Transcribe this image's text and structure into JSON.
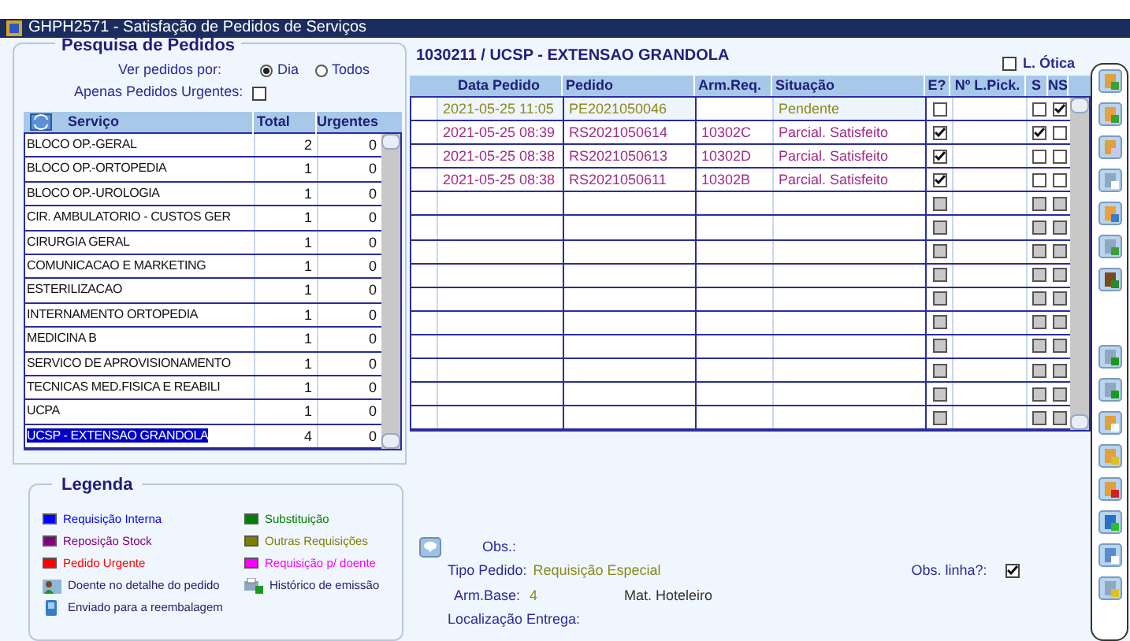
{
  "window": {
    "title": "GHPH2571 - Satisfação de Pedidos de Serviços"
  },
  "search": {
    "title": "Pesquisa de Pedidos",
    "view_label": "Ver pedidos por:",
    "view_options": [
      {
        "label": "Dia",
        "selected": true
      },
      {
        "label": "Todos",
        "selected": false
      }
    ],
    "urgent_label": "Apenas Pedidos Urgentes:",
    "urgent_checked": false
  },
  "services": {
    "columns": [
      "Serviço",
      "Total",
      "Urgentes"
    ],
    "rows": [
      {
        "name": "BLOCO OP.-GERAL",
        "total": "2",
        "urgent": "0",
        "selected": false
      },
      {
        "name": "BLOCO OP.-ORTOPEDIA",
        "total": "1",
        "urgent": "0",
        "selected": false
      },
      {
        "name": "BLOCO OP.-UROLOGIA",
        "total": "1",
        "urgent": "0",
        "selected": false
      },
      {
        "name": "CIR. AMBULATORIO - CUSTOS GER",
        "total": "1",
        "urgent": "0",
        "selected": false
      },
      {
        "name": "CIRURGIA GERAL",
        "total": "1",
        "urgent": "0",
        "selected": false
      },
      {
        "name": "COMUNICACAO E MARKETING",
        "total": "1",
        "urgent": "0",
        "selected": false
      },
      {
        "name": "ESTERILIZACAO",
        "total": "1",
        "urgent": "0",
        "selected": false
      },
      {
        "name": "INTERNAMENTO ORTOPEDIA",
        "total": "1",
        "urgent": "0",
        "selected": false
      },
      {
        "name": "MEDICINA B",
        "total": "1",
        "urgent": "0",
        "selected": false
      },
      {
        "name": "SERVICO DE APROVISIONAMENTO",
        "total": "1",
        "urgent": "0",
        "selected": false
      },
      {
        "name": "TECNICAS MED.FISICA E REABILI",
        "total": "1",
        "urgent": "0",
        "selected": false
      },
      {
        "name": "UCPA",
        "total": "1",
        "urgent": "0",
        "selected": false
      },
      {
        "name": "UCSP - EXTENSAO GRANDOLA",
        "total": "4",
        "urgent": "0",
        "selected": true
      }
    ]
  },
  "legend": {
    "title": "Legenda",
    "items": [
      {
        "kind": "swatch",
        "label": "Requisição Interna",
        "color": "#0000ff"
      },
      {
        "kind": "swatch",
        "label": "Substituição",
        "color": "#008000"
      },
      {
        "kind": "swatch",
        "label": "Reposição Stock",
        "color": "#800080"
      },
      {
        "kind": "swatch",
        "label": "Outras Requisições",
        "color": "#808000"
      },
      {
        "kind": "swatch",
        "label": "Pedido Urgente",
        "color": "#ff0000"
      },
      {
        "kind": "swatch",
        "label": "Requisição p/ doente",
        "color": "#ff00ff"
      },
      {
        "kind": "patient",
        "label": "Doente no detalhe do pedido"
      },
      {
        "kind": "history",
        "label": "Histórico de emissão"
      },
      {
        "kind": "sent",
        "label": "Enviado para a reembalagem"
      }
    ]
  },
  "orders": {
    "title": "1030211 / UCSP - EXTENSAO GRANDOLA",
    "optic_label": "L. Ótica",
    "optic_checked": false,
    "columns": [
      "Data Pedido",
      "Pedido",
      "Arm.Req.",
      "Situação",
      "E?",
      "Nº L.Pick.",
      "S",
      "NS"
    ],
    "rows": [
      {
        "kind": "order",
        "date": "2021-05-25 11:05",
        "order": "PE2021050046",
        "warehouse": "",
        "status": "Pendente",
        "color": "#8a8a1a",
        "e": false,
        "s": false,
        "ns": true,
        "selected": true
      },
      {
        "kind": "order",
        "date": "2021-05-25 08:39",
        "order": "RS2021050614",
        "warehouse": "10302C",
        "status": "Parcial. Satisfeito",
        "color": "#a02c86",
        "e": true,
        "s": true,
        "ns": false,
        "selected": false
      },
      {
        "kind": "order",
        "date": "2021-05-25 08:38",
        "order": "RS2021050613",
        "warehouse": "10302D",
        "status": "Parcial. Satisfeito",
        "color": "#a02c86",
        "e": true,
        "s": false,
        "ns": false,
        "selected": false
      },
      {
        "kind": "order",
        "date": "2021-05-25 08:38",
        "order": "RS2021050611",
        "warehouse": "10302B",
        "status": "Parcial. Satisfeito",
        "color": "#a02c86",
        "e": true,
        "s": false,
        "ns": false,
        "selected": false
      },
      {
        "kind": "empty",
        "e": false,
        "s": false,
        "ns": false,
        "disabled": true
      },
      {
        "kind": "empty",
        "e": false,
        "s": false,
        "ns": false,
        "disabled": true
      },
      {
        "kind": "empty",
        "e": false,
        "s": false,
        "ns": false,
        "disabled": true
      },
      {
        "kind": "empty",
        "e": false,
        "s": false,
        "ns": false,
        "disabled": true
      },
      {
        "kind": "empty",
        "e": false,
        "s": false,
        "ns": false,
        "disabled": true
      },
      {
        "kind": "empty",
        "e": false,
        "s": false,
        "ns": false,
        "disabled": true
      },
      {
        "kind": "empty",
        "e": false,
        "s": false,
        "ns": false,
        "disabled": true
      },
      {
        "kind": "empty",
        "e": false,
        "s": false,
        "ns": false,
        "disabled": true
      },
      {
        "kind": "empty",
        "e": false,
        "s": false,
        "ns": false,
        "disabled": true
      },
      {
        "kind": "empty",
        "e": false,
        "s": false,
        "ns": false,
        "disabled": true
      }
    ]
  },
  "details": {
    "obs_label": "Obs.:",
    "type_label": "Tipo Pedido:",
    "type_value": "Requisição Especial",
    "line_obs_label": "Obs. linha?:",
    "line_obs_checked": true,
    "base_label": "Arm.Base:",
    "base_value": "4",
    "base_name": "Mat. Hoteleiro",
    "location_label": "Localização Entrega:"
  }
}
